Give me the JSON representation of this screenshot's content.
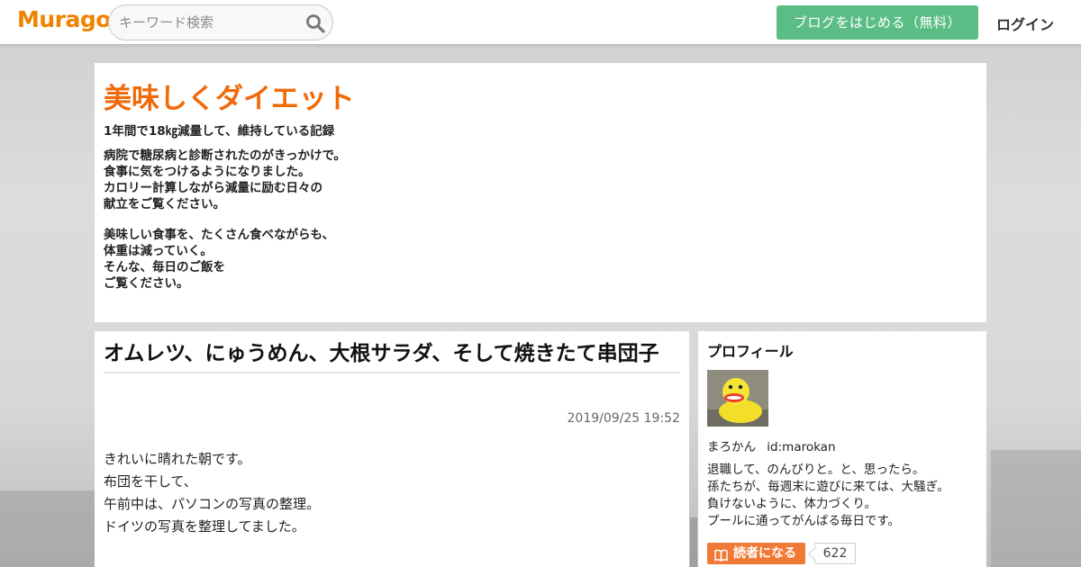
{
  "header": {
    "logo": "Muragon",
    "search_placeholder": "キーワード検索",
    "start_blog_label": "ブログをはじめる（無料）",
    "login_label": "ログイン"
  },
  "blog": {
    "title": "美味しくダイエット",
    "subtitle": "1年間で18㎏減量して、維持している記録",
    "description_1": [
      "病院で糖尿病と診断されたのがきっかけで。",
      "食事に気をつけるようになりました。",
      "カロリー計算しながら減量に励む日々の",
      "献立をご覧ください。"
    ],
    "description_2": [
      "美味しい食事を、たくさん食べながらも、",
      "体重は減っていく。",
      "そんな、毎日のご飯を",
      "ご覧ください。"
    ]
  },
  "article": {
    "title": "オムレツ、にゅうめん、大根サラダ、そして焼きたて串団子",
    "date": "2019/09/25 19:52",
    "body": [
      "きれいに晴れた朝です。",
      "布団を干して、",
      "午前中は、パソコンの写真の整理。",
      "ドイツの写真を整理してました。"
    ]
  },
  "profile": {
    "heading": "プロフィール",
    "name": "まろかん",
    "user_id": "id:marokan",
    "bio": [
      "退職して、のんびりと。と、思ったら。",
      "孫たちが、毎週末に遊びに来ては、大騒ぎ。",
      "負けないように、体力づくり。",
      "プールに通ってがんばる毎日です。"
    ],
    "follow_label": "読者になる",
    "follower_count": "622"
  },
  "colors": {
    "brand": "#f08300",
    "blog_title": "#f06a0a",
    "start_button": "#5bbd86",
    "follow_button": "#f07a35"
  },
  "icons": {
    "search": "search-icon",
    "follow": "book-icon"
  }
}
